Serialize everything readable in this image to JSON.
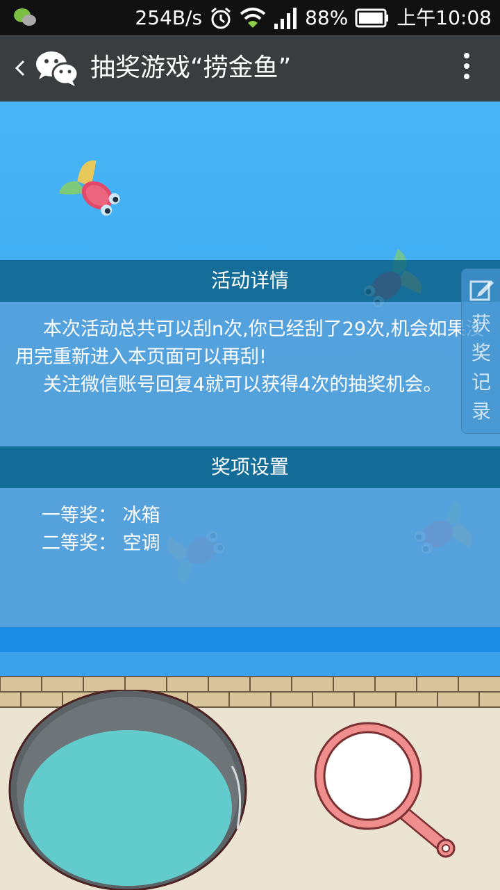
{
  "status_bar": {
    "net_speed": "254B/s",
    "battery": "88%",
    "time": "上午10:08"
  },
  "header": {
    "title": "抽奖游戏“捞金鱼”"
  },
  "activity": {
    "heading": "活动详情",
    "paragraphs": [
      "本次活动总共可以刮n次,你已经刮了29次,机会如果没用完重新进入本页面可以再刮!",
      "关注微信账号回复4就可以获得4次的抽奖机会。"
    ]
  },
  "prizes": {
    "heading": "奖项设置",
    "items": [
      "一等奖： 冰箱",
      "二等奖： 空调"
    ]
  },
  "side_tab": {
    "label": "获奖记录"
  },
  "colors": {
    "title_bar": "#3a3d3f",
    "sky": "#49b6f7",
    "panel_head": "#085c80",
    "pot_water": "#62cbcb",
    "net_ring": "#f08d8d"
  }
}
